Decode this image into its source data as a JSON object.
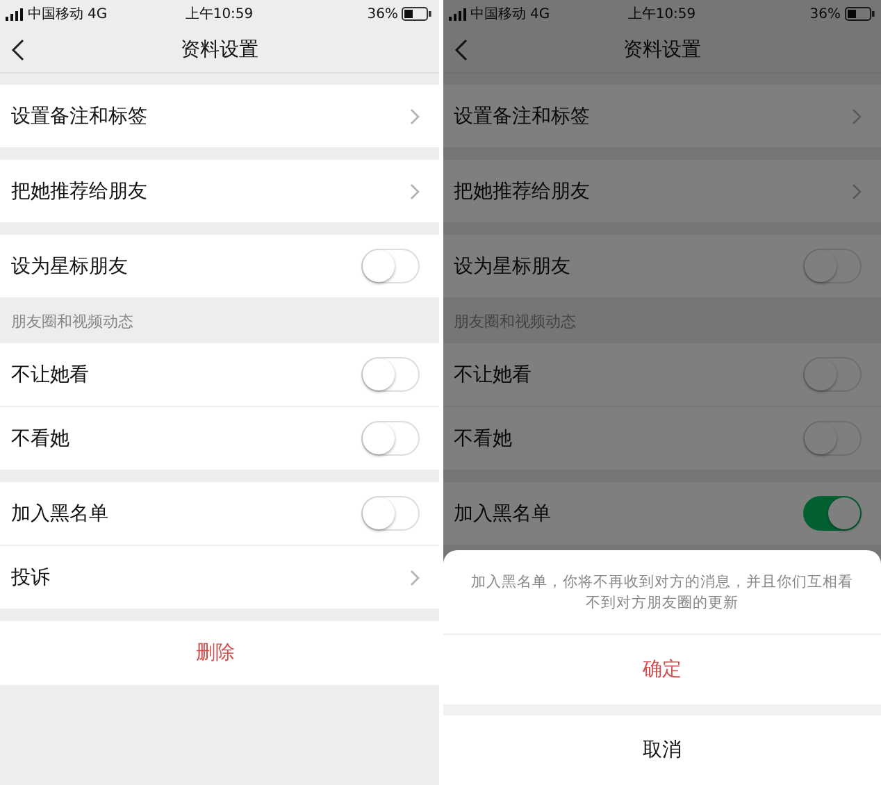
{
  "screens": [
    {
      "status_bar": {
        "carrier": "中国移动",
        "network": "4G",
        "time": "上午10:59",
        "battery": "36%"
      },
      "title": "资料设置",
      "groups": [
        {
          "rows": [
            {
              "label": "设置备注和标签",
              "kind": "link"
            }
          ]
        },
        {
          "rows": [
            {
              "label": "把她推荐给朋友",
              "kind": "link"
            }
          ]
        },
        {
          "rows": [
            {
              "label": "设为星标朋友",
              "kind": "toggle",
              "on": false
            }
          ]
        },
        {
          "header": "朋友圈和视频动态",
          "rows": [
            {
              "label": "不让她看",
              "kind": "toggle",
              "on": false
            },
            {
              "label": "不看她",
              "kind": "toggle",
              "on": false
            }
          ]
        },
        {
          "rows": [
            {
              "label": "加入黑名单",
              "kind": "toggle",
              "on": false
            },
            {
              "label": "投诉",
              "kind": "link"
            }
          ]
        },
        {
          "rows": [
            {
              "label": "删除",
              "kind": "danger"
            }
          ]
        }
      ]
    },
    {
      "status_bar": {
        "carrier": "中国移动",
        "network": "4G",
        "time": "上午10:59",
        "battery": "36%"
      },
      "title": "资料设置",
      "groups": [
        {
          "rows": [
            {
              "label": "设置备注和标签",
              "kind": "link"
            }
          ]
        },
        {
          "rows": [
            {
              "label": "把她推荐给朋友",
              "kind": "link"
            }
          ]
        },
        {
          "rows": [
            {
              "label": "设为星标朋友",
              "kind": "toggle",
              "on": false
            }
          ]
        },
        {
          "header": "朋友圈和视频动态",
          "rows": [
            {
              "label": "不让她看",
              "kind": "toggle",
              "on": false
            },
            {
              "label": "不看她",
              "kind": "toggle",
              "on": false
            }
          ]
        },
        {
          "rows": [
            {
              "label": "加入黑名单",
              "kind": "toggle",
              "on": true
            }
          ]
        }
      ],
      "sheet": {
        "message": "加入黑名单，你将不再收到对方的消息，并且你们互相看不到对方朋友圈的更新",
        "confirm": "确定",
        "cancel": "取消"
      }
    }
  ]
}
